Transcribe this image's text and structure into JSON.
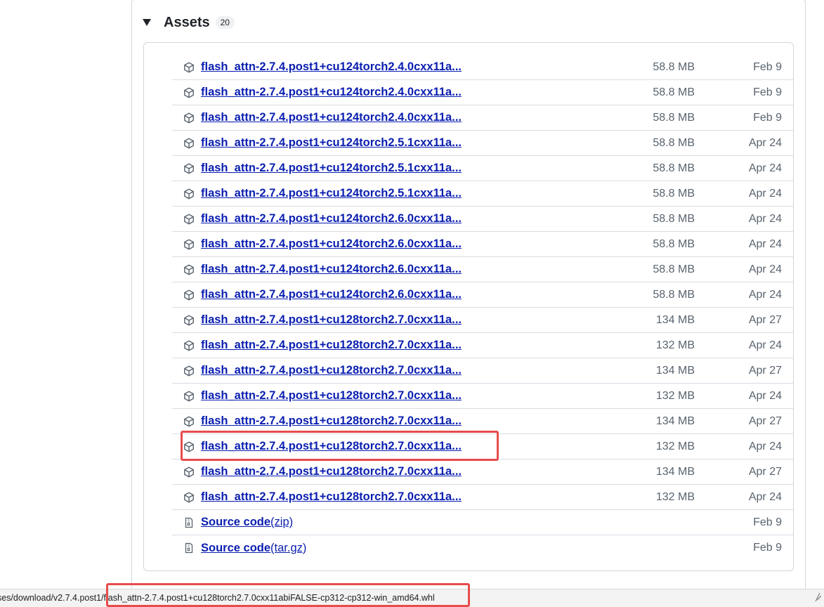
{
  "assets": {
    "title": "Assets",
    "count": "20",
    "items": [
      {
        "icon": "package-icon",
        "name": "flash_attn-2.7.4.post1+cu124torch2.4.0cxx11a...",
        "suffix": "",
        "size": "58.8 MB",
        "date": "Feb 9"
      },
      {
        "icon": "package-icon",
        "name": "flash_attn-2.7.4.post1+cu124torch2.4.0cxx11a...",
        "suffix": "",
        "size": "58.8 MB",
        "date": "Feb 9"
      },
      {
        "icon": "package-icon",
        "name": "flash_attn-2.7.4.post1+cu124torch2.4.0cxx11a...",
        "suffix": "",
        "size": "58.8 MB",
        "date": "Feb 9"
      },
      {
        "icon": "package-icon",
        "name": "flash_attn-2.7.4.post1+cu124torch2.5.1cxx11a...",
        "suffix": "",
        "size": "58.8 MB",
        "date": "Apr 24"
      },
      {
        "icon": "package-icon",
        "name": "flash_attn-2.7.4.post1+cu124torch2.5.1cxx11a...",
        "suffix": "",
        "size": "58.8 MB",
        "date": "Apr 24"
      },
      {
        "icon": "package-icon",
        "name": "flash_attn-2.7.4.post1+cu124torch2.5.1cxx11a...",
        "suffix": "",
        "size": "58.8 MB",
        "date": "Apr 24"
      },
      {
        "icon": "package-icon",
        "name": "flash_attn-2.7.4.post1+cu124torch2.6.0cxx11a...",
        "suffix": "",
        "size": "58.8 MB",
        "date": "Apr 24"
      },
      {
        "icon": "package-icon",
        "name": "flash_attn-2.7.4.post1+cu124torch2.6.0cxx11a...",
        "suffix": "",
        "size": "58.8 MB",
        "date": "Apr 24"
      },
      {
        "icon": "package-icon",
        "name": "flash_attn-2.7.4.post1+cu124torch2.6.0cxx11a...",
        "suffix": "",
        "size": "58.8 MB",
        "date": "Apr 24"
      },
      {
        "icon": "package-icon",
        "name": "flash_attn-2.7.4.post1+cu124torch2.6.0cxx11a...",
        "suffix": "",
        "size": "58.8 MB",
        "date": "Apr 24"
      },
      {
        "icon": "package-icon",
        "name": "flash_attn-2.7.4.post1+cu128torch2.7.0cxx11a...",
        "suffix": "",
        "size": "134 MB",
        "date": "Apr 27"
      },
      {
        "icon": "package-icon",
        "name": "flash_attn-2.7.4.post1+cu128torch2.7.0cxx11a...",
        "suffix": "",
        "size": "132 MB",
        "date": "Apr 24"
      },
      {
        "icon": "package-icon",
        "name": "flash_attn-2.7.4.post1+cu128torch2.7.0cxx11a...",
        "suffix": "",
        "size": "134 MB",
        "date": "Apr 27"
      },
      {
        "icon": "package-icon",
        "name": "flash_attn-2.7.4.post1+cu128torch2.7.0cxx11a...",
        "suffix": "",
        "size": "132 MB",
        "date": "Apr 24"
      },
      {
        "icon": "package-icon",
        "name": "flash_attn-2.7.4.post1+cu128torch2.7.0cxx11a...",
        "suffix": "",
        "size": "134 MB",
        "date": "Apr 27"
      },
      {
        "icon": "package-icon",
        "name": "flash_attn-2.7.4.post1+cu128torch2.7.0cxx11a...",
        "suffix": "",
        "size": "132 MB",
        "date": "Apr 24"
      },
      {
        "icon": "package-icon",
        "name": "flash_attn-2.7.4.post1+cu128torch2.7.0cxx11a...",
        "suffix": "",
        "size": "134 MB",
        "date": "Apr 27"
      },
      {
        "icon": "package-icon",
        "name": "flash_attn-2.7.4.post1+cu128torch2.7.0cxx11a...",
        "suffix": "",
        "size": "132 MB",
        "date": "Apr 24"
      },
      {
        "icon": "file-zip-icon",
        "name": "Source code",
        "suffix": "(zip)",
        "size": "",
        "date": "Feb 9"
      },
      {
        "icon": "file-zip-icon",
        "name": "Source code",
        "suffix": "(tar.gz)",
        "size": "",
        "date": "Feb 9"
      }
    ]
  },
  "status_bar": {
    "url": "ses/download/v2.7.4.post1/flash_attn-2.7.4.post1+cu128torch2.7.0cxx11abiFALSE-cp312-cp312-win_amd64.whl"
  },
  "colors": {
    "link": "#0a1eb0",
    "muted": "#59636e",
    "border": "#d0d7de",
    "highlight": "#e84c4c"
  }
}
